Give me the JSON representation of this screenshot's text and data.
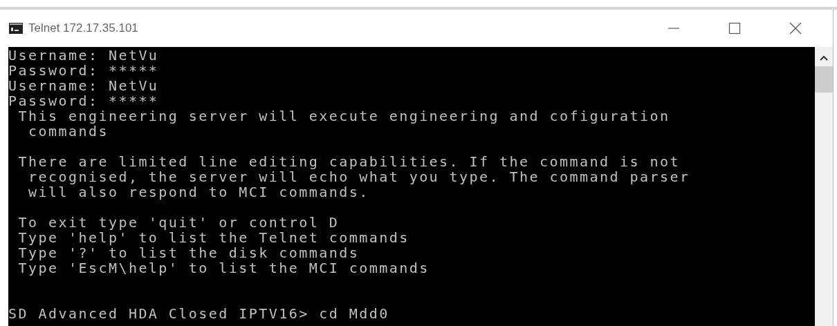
{
  "window": {
    "title": "Telnet 172.17.35.101"
  },
  "console": {
    "blocks": [
      {
        "lines": [
          "Username: NetVu",
          "Password: *****",
          "Username: NetVu",
          "Password: *****",
          " This engineering server will execute engineering and cofiguration",
          "  commands"
        ]
      },
      {
        "lines": [
          " There are limited line editing capabilities. If the command is not",
          "  recognised, the server will echo what you type. The command parser",
          "  will also respond to MCI commands."
        ]
      },
      {
        "lines": [
          " To exit type 'quit' or control D",
          " Type 'help' to list the Telnet commands",
          " Type '?' to list the disk commands",
          " Type 'EscM\\help' to list the MCI commands"
        ]
      }
    ],
    "prompt": "SD Advanced HDA Closed IPTV16> cd Mdd0"
  }
}
